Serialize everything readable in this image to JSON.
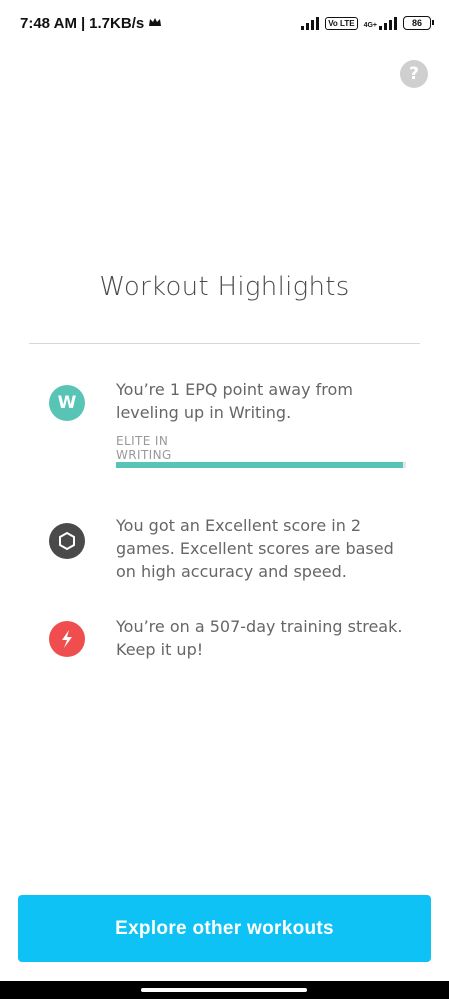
{
  "status_bar": {
    "time": "7:48 AM",
    "speed": "1.7KB/s",
    "volte": "Vo LTE",
    "network": "4G+",
    "battery": "86"
  },
  "help": {
    "label": "?"
  },
  "page": {
    "title": "Workout Highlights"
  },
  "highlights": [
    {
      "icon": "writing-icon",
      "icon_label": "W",
      "icon_color": "#57c4b5",
      "text": "You’re 1 EPQ point away from leveling up in Writing.",
      "caption": "ELITE IN WRITING",
      "progress": 0.99
    },
    {
      "icon": "hexagon-icon",
      "icon_color": "#4a4a4a",
      "text": "You got an Excellent score in 2 games. Excellent scores are based on high accuracy and speed."
    },
    {
      "icon": "lightning-icon",
      "icon_color": "#f04e4e",
      "text": "You’re on a 507-day training streak. Keep it up!"
    }
  ],
  "cta": {
    "label": "Explore other workouts"
  }
}
